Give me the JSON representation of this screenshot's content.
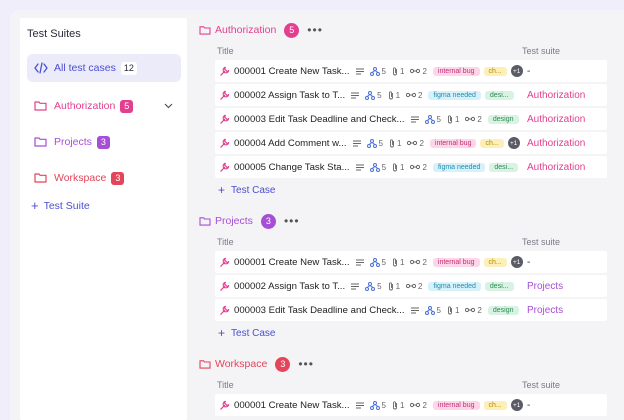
{
  "colors": {
    "accent": "#4b4fd1",
    "authorization": "#e2408f",
    "projects": "#a64ed6",
    "workspace": "#e3455a"
  },
  "sidebar": {
    "title": "Test Suites",
    "items": [
      {
        "label": "All test cases",
        "count": "12",
        "icon": "code-icon"
      },
      {
        "label": "Authorization",
        "count": "5",
        "icon": "folder-icon"
      },
      {
        "label": "Projects",
        "count": "3",
        "icon": "folder-icon"
      },
      {
        "label": "Workspace",
        "count": "3",
        "icon": "folder-icon"
      }
    ],
    "add_label": "Test Suite"
  },
  "columns": {
    "title": "Title",
    "suite": "Test suite"
  },
  "add_case_label": "Test Case",
  "groups": [
    {
      "name": "Authorization",
      "count": "5",
      "rows": [
        {
          "title": "000001 Create New Task...",
          "subtasks": "5",
          "attachments": "1",
          "links": "2",
          "tags": [
            "internal bug",
            "ch..."
          ],
          "extra": "+1",
          "suite": "-"
        },
        {
          "title": "000002 Assign Task to T...",
          "subtasks": "5",
          "attachments": "1",
          "links": "2",
          "tags": [
            "figma needed",
            "desi..."
          ],
          "extra": "",
          "suite": "Authorization"
        },
        {
          "title": "000003 Edit Task Deadline and Check...",
          "subtasks": "5",
          "attachments": "1",
          "links": "2",
          "tags": [
            "design"
          ],
          "extra": "",
          "suite": "Authorization"
        },
        {
          "title": "000004 Add Comment w...",
          "subtasks": "5",
          "attachments": "1",
          "links": "2",
          "tags": [
            "internal bug",
            "ch..."
          ],
          "extra": "+1",
          "suite": "Authorization"
        },
        {
          "title": "000005 Change Task Sta...",
          "subtasks": "5",
          "attachments": "1",
          "links": "2",
          "tags": [
            "figma needed",
            "desi..."
          ],
          "extra": "",
          "suite": "Authorization"
        }
      ]
    },
    {
      "name": "Projects",
      "count": "3",
      "rows": [
        {
          "title": "000001 Create New Task...",
          "subtasks": "5",
          "attachments": "1",
          "links": "2",
          "tags": [
            "internal bug",
            "ch..."
          ],
          "extra": "+1",
          "suite": "-"
        },
        {
          "title": "000002 Assign Task to T...",
          "subtasks": "5",
          "attachments": "1",
          "links": "2",
          "tags": [
            "figma needed",
            "desi..."
          ],
          "extra": "",
          "suite": "Projects"
        },
        {
          "title": "000003 Edit Task Deadline and Check...",
          "subtasks": "5",
          "attachments": "1",
          "links": "2",
          "tags": [
            "design"
          ],
          "extra": "",
          "suite": "Projects"
        }
      ]
    },
    {
      "name": "Workspace",
      "count": "3",
      "rows": [
        {
          "title": "000001 Create New Task...",
          "subtasks": "5",
          "attachments": "1",
          "links": "2",
          "tags": [
            "internal bug",
            "ch..."
          ],
          "extra": "+1",
          "suite": "-"
        }
      ]
    }
  ]
}
